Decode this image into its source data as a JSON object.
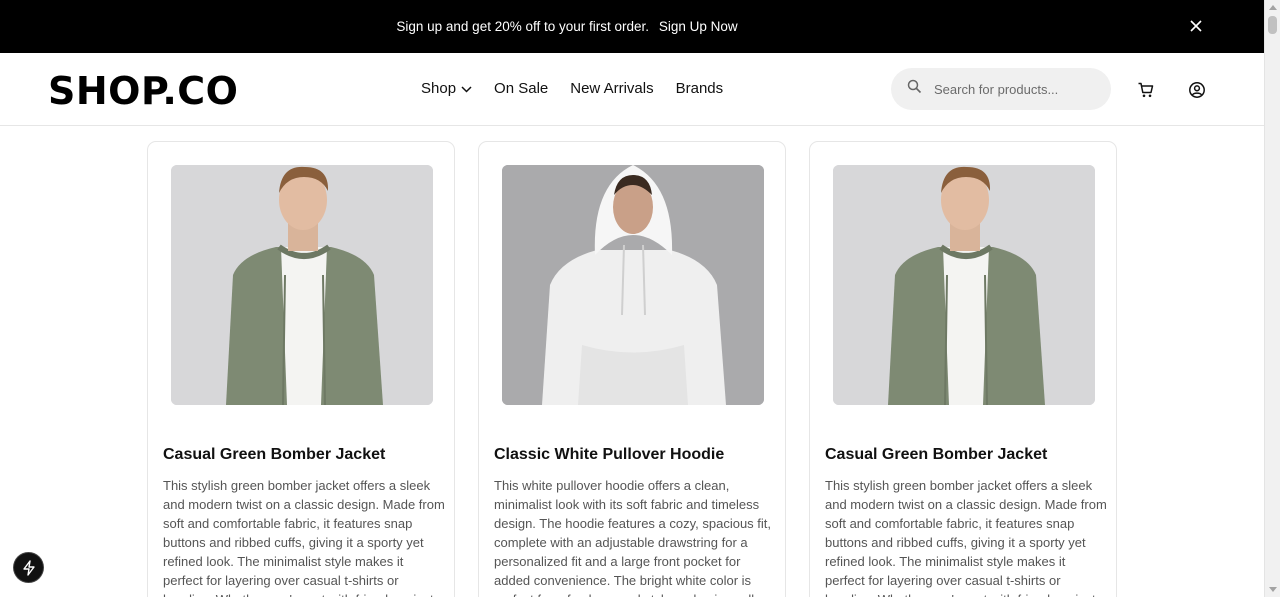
{
  "promo": {
    "message": "Sign up and get 20% off to your first order.",
    "cta": "Sign Up Now",
    "close_icon": "close-icon"
  },
  "header": {
    "logo": "SHOP.CO",
    "nav": [
      {
        "label": "Shop",
        "has_dropdown": true
      },
      {
        "label": "On Sale"
      },
      {
        "label": "New Arrivals"
      },
      {
        "label": "Brands"
      }
    ],
    "search_placeholder": "Search for products...",
    "icons": [
      "search-icon",
      "cart-icon",
      "account-icon"
    ]
  },
  "products": [
    {
      "title": "Casual Green Bomber Jacket",
      "description": "This stylish green bomber jacket offers a sleek and modern twist on a classic design. Made from soft and comfortable fabric, it features snap buttons and ribbed cuffs, giving it a sporty yet refined look. The minimalist style makes it perfect for layering over casual t-shirts or hoodies. Whether you're out with friends or just",
      "image": "green-bomber-jacket-model"
    },
    {
      "title": "Classic White Pullover Hoodie",
      "description": "This white pullover hoodie offers a clean, minimalist look with its soft fabric and timeless design. The hoodie features a cozy, spacious fit, complete with an adjustable drawstring for a personalized fit and a large front pocket for added convenience. The bright white color is perfect for a fresh, casual style and pairs well",
      "image": "white-hoodie-model"
    },
    {
      "title": "Casual Green Bomber Jacket",
      "description": "This stylish green bomber jacket offers a sleek and modern twist on a classic design. Made from soft and comfortable fabric, it features snap buttons and ribbed cuffs, giving it a sporty yet refined look. The minimalist style makes it perfect for layering over casual t-shirts or hoodies. Whether you're out with friends or just",
      "image": "green-bomber-jacket-model"
    }
  ],
  "fab_icon": "lightning-icon"
}
